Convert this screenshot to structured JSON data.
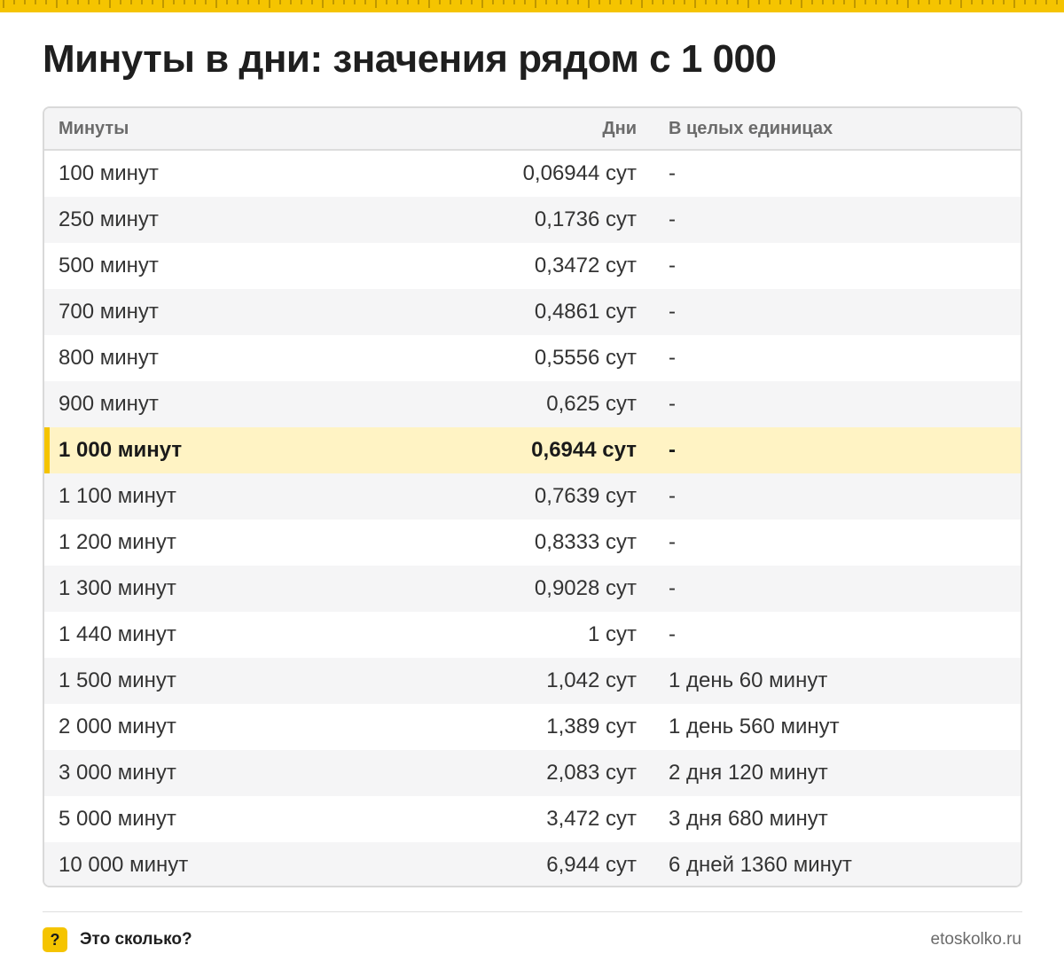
{
  "title": "Минуты в дни: значения рядом с 1 000",
  "colors": {
    "accent": "#f5c400",
    "highlight_row": "#fff3c4",
    "alt_row": "#f5f5f6"
  },
  "table": {
    "headers": [
      "Минуты",
      "Дни",
      "В целых единицах"
    ],
    "highlight_index": 6,
    "rows": [
      [
        "100 минут",
        "0,06944 сут",
        "-"
      ],
      [
        "250 минут",
        "0,1736 сут",
        "-"
      ],
      [
        "500 минут",
        "0,3472 сут",
        "-"
      ],
      [
        "700 минут",
        "0,4861 сут",
        "-"
      ],
      [
        "800 минут",
        "0,5556 сут",
        "-"
      ],
      [
        "900 минут",
        "0,625 сут",
        "-"
      ],
      [
        "1 000 минут",
        "0,6944 сут",
        "-"
      ],
      [
        "1 100 минут",
        "0,7639 сут",
        "-"
      ],
      [
        "1 200 минут",
        "0,8333 сут",
        "-"
      ],
      [
        "1 300 минут",
        "0,9028 сут",
        "-"
      ],
      [
        "1 440 минут",
        "1 сут",
        "-"
      ],
      [
        "1 500 минут",
        "1,042 сут",
        "1 день 60 минут"
      ],
      [
        "2 000 минут",
        "1,389 сут",
        "1 день 560 минут"
      ],
      [
        "3 000 минут",
        "2,083 сут",
        "2 дня 120 минут"
      ],
      [
        "5 000 минут",
        "3,472 сут",
        "3 дня 680 минут"
      ],
      [
        "10 000 минут",
        "6,944 сут",
        "6 дней 1360 минут"
      ]
    ]
  },
  "footer": {
    "logo_icon": "question-mark-icon",
    "logo_glyph": "?",
    "brand": "Это сколько?",
    "site": "etoskolko.ru"
  }
}
